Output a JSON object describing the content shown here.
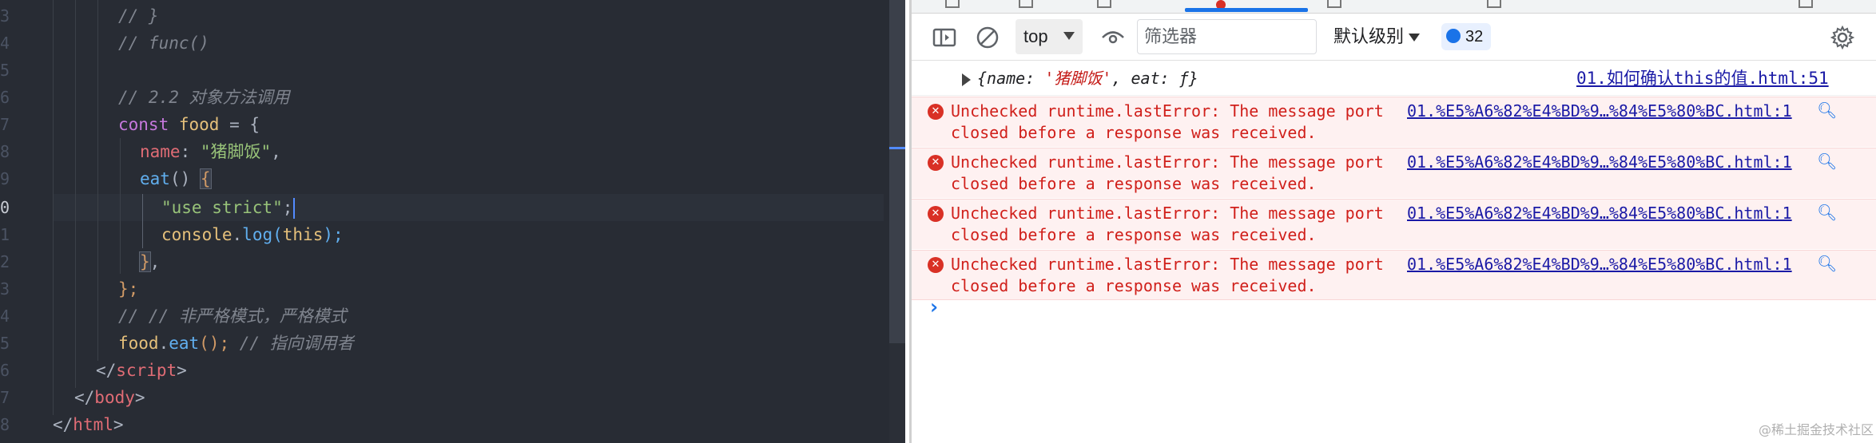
{
  "editor": {
    "line_numbers": [
      "3",
      "4",
      "5",
      "6",
      "7",
      "8",
      "9",
      "0",
      "1",
      "2",
      "3",
      "4",
      "5",
      "6",
      "7",
      "8"
    ],
    "active_line_number": "0",
    "lines": {
      "l1": "// }",
      "l2": "// func()",
      "l4": "// 2.2 对象方法调用",
      "l5_kw": "const",
      "l5_var": "food",
      "l5_rest": " = {",
      "l6_prop": "name",
      "l6_colon": ": ",
      "l6_str": "\"猪脚饭\"",
      "l6_end": ",",
      "l7_fn": "eat",
      "l7_paren": "() ",
      "l7_brace": "{",
      "l8_str": "\"use strict\"",
      "l8_end": ";",
      "l9_obj": "console",
      "l9_dot": ".",
      "l9_fn": "log",
      "l9_open": "(",
      "l9_kw": "this",
      "l9_close": ");",
      "l10_brace": "}",
      "l10_end": ",",
      "l11": "};",
      "l12": "// // 非严格模式，严格模式",
      "l13_var": "food",
      "l13_dot": ".",
      "l13_fn": "eat",
      "l13_end": "(); ",
      "l13_cmt": "// 指向调用者",
      "l14_open": "</",
      "l14_tag": "script",
      "l14_close": ">",
      "l15_open": "</",
      "l15_tag": "body",
      "l15_close": ">",
      "l16_open": "</",
      "l16_tag": "html",
      "l16_close": ">"
    }
  },
  "devtools": {
    "toolbar": {
      "context": "top",
      "filter_placeholder": "筛选器",
      "levels": "默认级别",
      "issues_count": "32"
    },
    "log": {
      "object_open": "{",
      "key_name": "name",
      "sep1": ": ",
      "val_name": "'猪脚饭'",
      "sep2": ", ",
      "key_eat": "eat",
      "sep3": ": ",
      "val_eat": "ƒ",
      "object_close": "}",
      "source": "01.如何确认this的值.html:51"
    },
    "errors": [
      {
        "text": "Unchecked runtime.lastError: The message port closed before a response was received.",
        "source": "01.%E5%A6%82%E4%BD%9…%84%E5%80%BC.html:1"
      },
      {
        "text": "Unchecked runtime.lastError: The message port closed before a response was received.",
        "source": "01.%E5%A6%82%E4%BD%9…%84%E5%80%BC.html:1"
      },
      {
        "text": "Unchecked runtime.lastError: The message port closed before a response was received.",
        "source": "01.%E5%A6%82%E4%BD%9…%84%E5%80%BC.html:1"
      },
      {
        "text": "Unchecked runtime.lastError: The message port closed before a response was received.",
        "source": "01.%E5%A6%82%E4%BD%9…%84%E5%80%BC.html:1"
      }
    ],
    "prompt_symbol": "›"
  },
  "watermark": "@稀土掘金技术社区",
  "icons": {
    "sidebar": "sidebar-toggle-icon",
    "clear": "clear-console-icon",
    "eye": "live-expression-icon",
    "settings": "gear-icon",
    "error": "error-icon",
    "search": "search-icon"
  }
}
